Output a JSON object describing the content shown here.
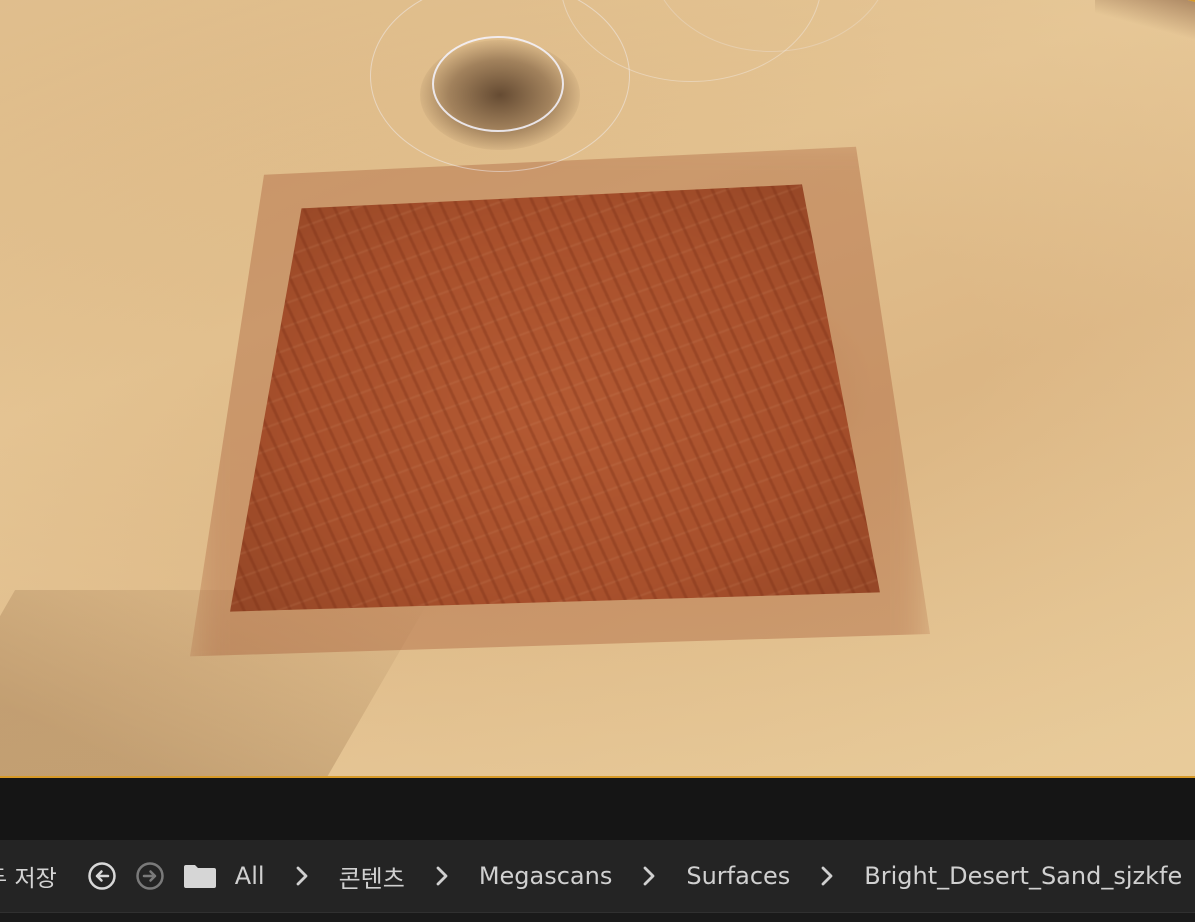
{
  "colors": {
    "selection_outline": "#d79a28",
    "toolbar_bg": "#242424",
    "text": "#d0d0d0"
  },
  "toolbar": {
    "save_all_label": "두 저장",
    "back_icon": "back-arrow-circle-icon",
    "forward_icon": "forward-arrow-circle-icon",
    "folder_icon": "folder-icon"
  },
  "breadcrumb": {
    "items": [
      {
        "label": "All"
      },
      {
        "label": "콘텐츠"
      },
      {
        "label": "Megascans"
      },
      {
        "label": "Surfaces"
      },
      {
        "label": "Bright_Desert_Sand_sjzkfe"
      }
    ],
    "separator_icon": "chevron-right-icon"
  }
}
